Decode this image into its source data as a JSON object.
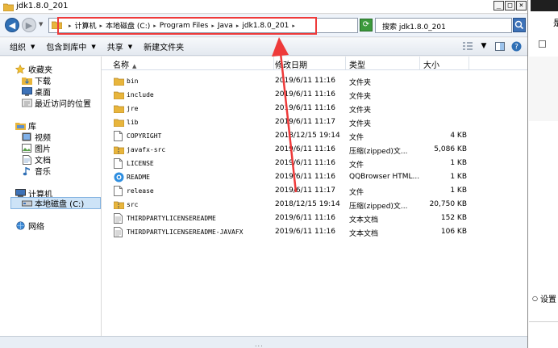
{
  "window": {
    "title": "jdk1.8.0_201",
    "controls": {
      "minimize": "_",
      "maximize": "□",
      "close": "×"
    }
  },
  "address": {
    "crumbs": [
      "计算机",
      "本地磁盘 (C:)",
      "Program Files",
      "Java",
      "jdk1.8.0_201"
    ],
    "search_placeholder": "搜索 jdk1.8.0_201"
  },
  "toolbar": {
    "organize": "组织",
    "include_in_library": "包含到库中",
    "share": "共享",
    "new_folder": "新建文件夹"
  },
  "nav": {
    "favorites": "收藏夹",
    "downloads": "下载",
    "desktop": "桌面",
    "recent": "最近访问的位置",
    "libraries": "库",
    "videos": "视频",
    "pictures": "图片",
    "documents": "文档",
    "music": "音乐",
    "computer": "计算机",
    "local_disk": "本地磁盘 (C:)",
    "network": "网络"
  },
  "columns": {
    "name": "名称",
    "date": "修改日期",
    "type": "类型",
    "size": "大小"
  },
  "files": [
    {
      "icon": "folder-icon",
      "name": "bin",
      "date": "2019/6/11 11:16",
      "type": "文件夹",
      "size": ""
    },
    {
      "icon": "folder-icon",
      "name": "include",
      "date": "2019/6/11 11:16",
      "type": "文件夹",
      "size": ""
    },
    {
      "icon": "folder-icon",
      "name": "jre",
      "date": "2019/6/11 11:16",
      "type": "文件夹",
      "size": ""
    },
    {
      "icon": "folder-icon",
      "name": "lib",
      "date": "2019/6/11 11:17",
      "type": "文件夹",
      "size": ""
    },
    {
      "icon": "file-icon",
      "name": "COPYRIGHT",
      "date": "2018/12/15 19:14",
      "type": "文件",
      "size": "4 KB"
    },
    {
      "icon": "zip-icon",
      "name": "javafx-src",
      "date": "2019/6/11 11:16",
      "type": "压缩(zipped)文...",
      "size": "5,086 KB"
    },
    {
      "icon": "file-icon",
      "name": "LICENSE",
      "date": "2019/6/11 11:16",
      "type": "文件",
      "size": "1 KB"
    },
    {
      "icon": "browser-icon",
      "name": "README",
      "date": "2019/6/11 11:16",
      "type": "QQBrowser HTML...",
      "size": "1 KB"
    },
    {
      "icon": "file-icon",
      "name": "release",
      "date": "2019/6/11 11:17",
      "type": "文件",
      "size": "1 KB"
    },
    {
      "icon": "zip-icon",
      "name": "src",
      "date": "2018/12/15 19:14",
      "type": "压缩(zipped)文...",
      "size": "20,750 KB"
    },
    {
      "icon": "text-file-icon",
      "name": "THIRDPARTYLICENSEREADME",
      "date": "2019/6/11 11:16",
      "type": "文本文档",
      "size": "152 KB"
    },
    {
      "icon": "text-file-icon",
      "name": "THIRDPARTYLICENSEREADME-JAVAFX",
      "date": "2019/6/11 11:16",
      "type": "文本文档",
      "size": "106 KB"
    }
  ],
  "side_app": {
    "settings": "设置",
    "top_glyph": "是"
  },
  "colors": {
    "highlight": "#ee3a3a",
    "annotation_arrow": "#ee3a3a",
    "folder": "#e8b53c",
    "selection": "#cde3f7"
  }
}
